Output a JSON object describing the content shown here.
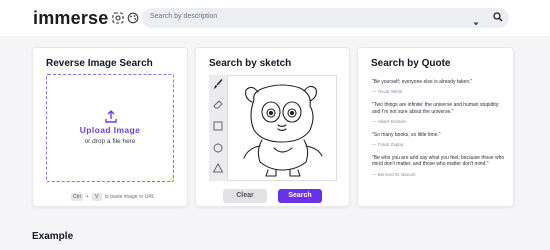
{
  "header": {
    "logo": "immerse",
    "search_placeholder": "Search by description",
    "icons": [
      "image-search-icon",
      "palette-icon",
      "chevron-down-icon",
      "search-icon"
    ]
  },
  "reverse_search": {
    "title": "Reverse Image Search",
    "upload_label": "Upload Image",
    "drop_hint": "or drop a file here",
    "kbd_ctrl": "Ctrl",
    "kbd_plus": "+",
    "kbd_v": "V",
    "paste_hint": "to paste image or URL"
  },
  "sketch_search": {
    "title": "Search by sketch",
    "tools": [
      "brush-icon",
      "eraser-icon",
      "square-icon",
      "circle-icon",
      "triangle-icon"
    ],
    "clear_label": "Clear",
    "search_label": "Search"
  },
  "quote_search": {
    "title": "Search by Quote",
    "quotes": [
      {
        "text": "\"Be yourself; everyone else is already taken.\"",
        "author": "— Oscar Wilde"
      },
      {
        "text": "\"Two things are infinite: the universe and human stupidity; and I'm not sure about the universe.\"",
        "author": "— Albert Einstein"
      },
      {
        "text": "\"So many books, so little time.\"",
        "author": "— Frank Zappa"
      },
      {
        "text": "\"Be who you are and say what you feel, because those who mind don't matter, and those who matter don't mind.\"",
        "author": "— Bernard M. Baruch"
      }
    ]
  },
  "section": {
    "title": "Example"
  },
  "colors": {
    "accent": "#6a32e8",
    "background": "#f5f5f7"
  }
}
